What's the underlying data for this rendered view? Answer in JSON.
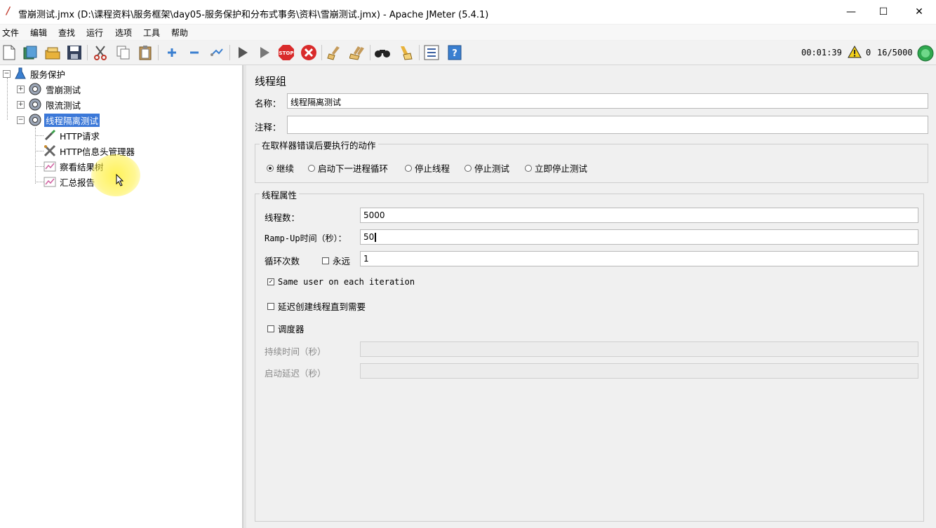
{
  "window": {
    "title": "雪崩测试.jmx (D:\\课程资料\\服务框架\\day05-服务保护和分布式事务\\资料\\雪崩测试.jmx) - Apache JMeter (5.4.1)",
    "minimize": "—",
    "maximize": "☐",
    "close": "✕"
  },
  "menu": [
    "文件",
    "编辑",
    "查找",
    "运行",
    "选项",
    "工具",
    "帮助"
  ],
  "toolbar_icons": [
    "new-icon",
    "templates-icon",
    "open-icon",
    "save-icon",
    "cut-icon",
    "copy-icon",
    "paste-icon",
    "expand-icon",
    "collapse-icon",
    "toggle-icon",
    "start-icon",
    "start-no-pause-icon",
    "stop-icon",
    "shutdown-icon",
    "clear-icon",
    "clear-all-icon",
    "search-icon",
    "reset-search-icon",
    "function-helper-icon",
    "help-icon"
  ],
  "status": {
    "elapsed": "00:01:39",
    "errors": "0",
    "threads": "16/5000"
  },
  "tree": {
    "root": "服务保护",
    "groups": [
      "雪崩测试",
      "限流测试",
      "线程隔离测试"
    ],
    "children": [
      "HTTP请求",
      "HTTP信息头管理器",
      "察看结果树",
      "汇总报告"
    ]
  },
  "panel": {
    "title": "线程组",
    "name_label": "名称：",
    "name_value": "线程隔离测试",
    "comment_label": "注释：",
    "comment_value": "",
    "error_group_label": "在取样器错误后要执行的动作",
    "error_options": [
      "继续",
      "启动下一进程循环",
      "停止线程",
      "停止测试",
      "立即停止测试"
    ],
    "thread_props_label": "线程属性",
    "threads_label": "线程数：",
    "threads_value": "5000",
    "rampup_label": "Ramp-Up时间（秒）：",
    "rampup_value": "50",
    "loop_label": "循环次数",
    "forever_label": "永远",
    "loop_value": "1",
    "same_user_label": "Same user on each iteration",
    "delay_label": "延迟创建线程直到需要",
    "scheduler_label": "调度器",
    "duration_label": "持续时间（秒）",
    "startup_delay_label": "启动延迟（秒）"
  }
}
